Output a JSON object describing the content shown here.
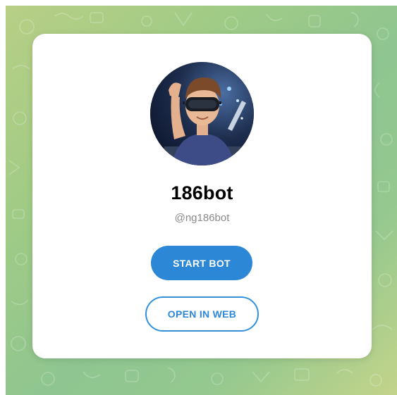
{
  "profile": {
    "name": "186bot",
    "username": "@ng186bot",
    "avatar_alt": "bot-avatar-vr-boy"
  },
  "actions": {
    "start_label": "START BOT",
    "web_label": "OPEN IN WEB"
  },
  "colors": {
    "accent": "#2d87d7",
    "background_green": "#9fcb86",
    "card": "#ffffff",
    "username_gray": "#8a8a8a"
  }
}
